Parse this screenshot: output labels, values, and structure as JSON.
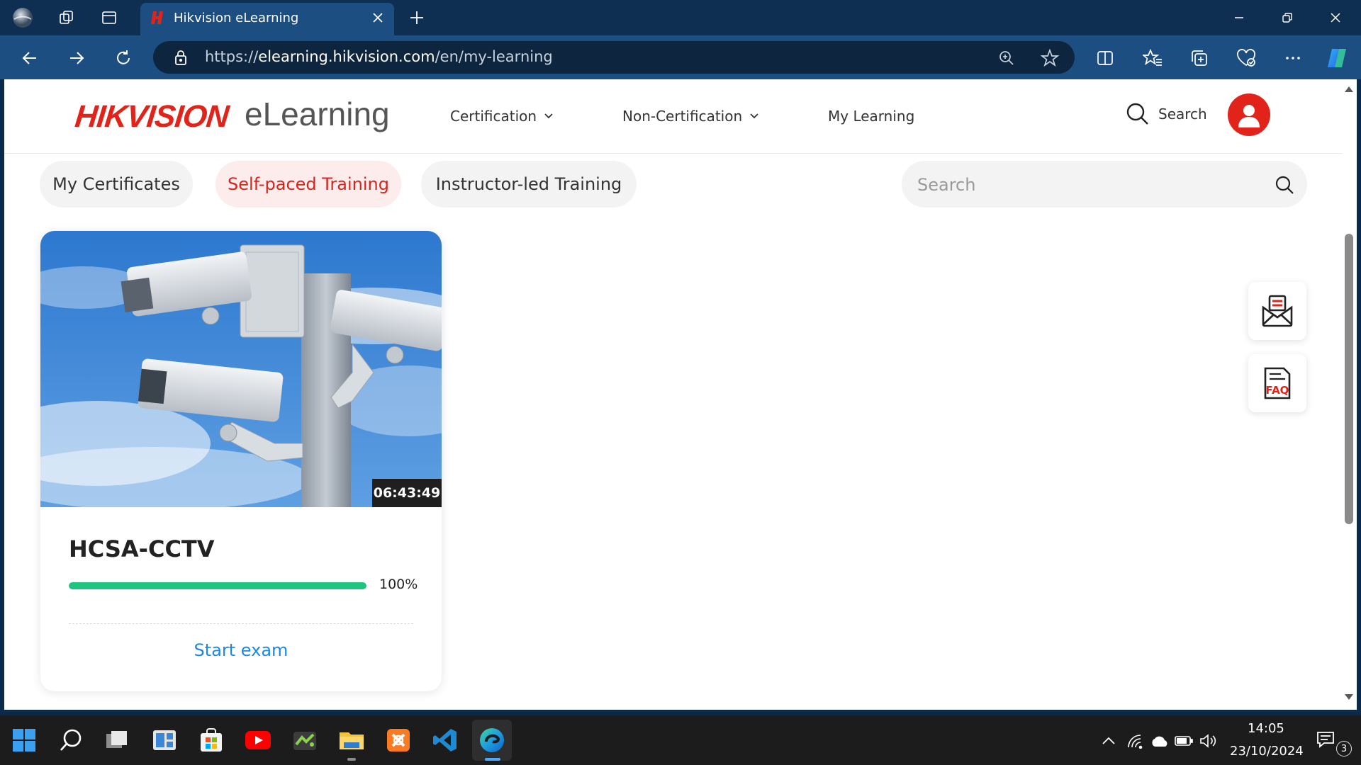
{
  "browser": {
    "tab_title": "Hikvision eLearning",
    "url_scheme": "https://",
    "url_host": "elearning.hikvision.com",
    "url_path": "/en/my-learning"
  },
  "site": {
    "brand": "HIKVISION",
    "product": "eLearning",
    "nav": {
      "certification": "Certification",
      "non_certification": "Non-Certification",
      "my_learning": "My Learning",
      "search": "Search"
    }
  },
  "filters": {
    "my_certificates": "My Certificates",
    "self_paced": "Self-paced Training",
    "instructor_led": "Instructor-led Training",
    "search_placeholder": "Search"
  },
  "course": {
    "duration": "06:43:49",
    "title": "HCSA-CCTV",
    "progress": 100,
    "progress_label": "100%",
    "action": "Start exam"
  },
  "side_buttons": {
    "faq_label": "FAQ"
  },
  "taskbar": {
    "time": "14:05",
    "date": "23/10/2024",
    "notification_count": "3"
  },
  "colors": {
    "brand_red": "#e2231a",
    "progress_green": "#1ec580",
    "link_blue": "#1e88e5",
    "browser_frame": "#1d4e82"
  },
  "icons": {
    "tab_actions": "tab-actions-icon",
    "workspaces": "workspaces-icon",
    "favorites": "favorites-icon",
    "copilot": "copilot-icon",
    "mail": "mail-icon",
    "faq": "faq-icon"
  }
}
